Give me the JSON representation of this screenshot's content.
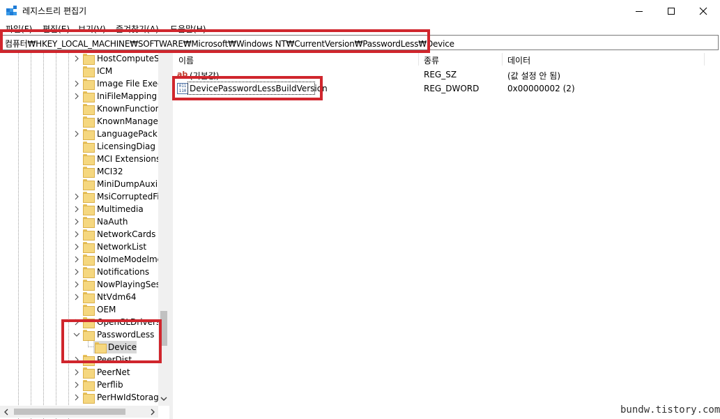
{
  "window": {
    "title": "레지스트리 편집기",
    "accent_highlight_color": "#d0262d"
  },
  "menu": [
    "파일(F)",
    "편집(E)",
    "보기(V)",
    "즐겨찾기(A)",
    "도움말(H)"
  ],
  "address": {
    "path": "컴퓨터₩HKEY_LOCAL_MACHINE₩SOFTWARE₩Microsoft₩Windows NT₩CurrentVersion₩PasswordLess₩Device"
  },
  "tree": {
    "items": [
      {
        "label": "HostComputeSe",
        "expander": "collapsed"
      },
      {
        "label": "ICM",
        "expander": "none"
      },
      {
        "label": "Image File Execu",
        "expander": "collapsed"
      },
      {
        "label": "IniFileMapping",
        "expander": "collapsed"
      },
      {
        "label": "KnownFunctionT",
        "expander": "none"
      },
      {
        "label": "KnownManaged",
        "expander": "none"
      },
      {
        "label": "LanguagePack",
        "expander": "collapsed"
      },
      {
        "label": "LicensingDiag",
        "expander": "none"
      },
      {
        "label": "MCI Extensions",
        "expander": "none"
      },
      {
        "label": "MCI32",
        "expander": "none"
      },
      {
        "label": "MiniDumpAuxil",
        "expander": "none"
      },
      {
        "label": "MsiCorruptedFil",
        "expander": "collapsed"
      },
      {
        "label": "Multimedia",
        "expander": "collapsed"
      },
      {
        "label": "NaAuth",
        "expander": "collapsed"
      },
      {
        "label": "NetworkCards",
        "expander": "collapsed"
      },
      {
        "label": "NetworkList",
        "expander": "collapsed"
      },
      {
        "label": "NoImeModelme",
        "expander": "collapsed"
      },
      {
        "label": "Notifications",
        "expander": "collapsed"
      },
      {
        "label": "NowPlayingSess",
        "expander": "collapsed"
      },
      {
        "label": "NtVdm64",
        "expander": "collapsed"
      },
      {
        "label": "OEM",
        "expander": "none"
      },
      {
        "label": "OpenGLDrivers",
        "expander": "collapsed"
      },
      {
        "label": "PasswordLess",
        "expander": "expanded"
      },
      {
        "label": "Device",
        "expander": "child"
      },
      {
        "label": "PeerDist",
        "expander": "collapsed"
      },
      {
        "label": "PeerNet",
        "expander": "collapsed"
      },
      {
        "label": "Perflib",
        "expander": "collapsed"
      },
      {
        "label": "PerHwIdStorage",
        "expander": "collapsed"
      }
    ]
  },
  "list": {
    "columns": [
      "이름",
      "종류",
      "데이터"
    ],
    "rows": [
      {
        "name": "(기본값)",
        "type": "REG_SZ",
        "data": "(값 설정 안 됨)",
        "icon": "string-value-icon"
      },
      {
        "name": "DevicePasswordLessBuildVersion",
        "type": "REG_DWORD",
        "data": "0x00000002 (2)",
        "icon": "dword-value-icon"
      }
    ]
  },
  "watermark": "bundw.tistory.com"
}
